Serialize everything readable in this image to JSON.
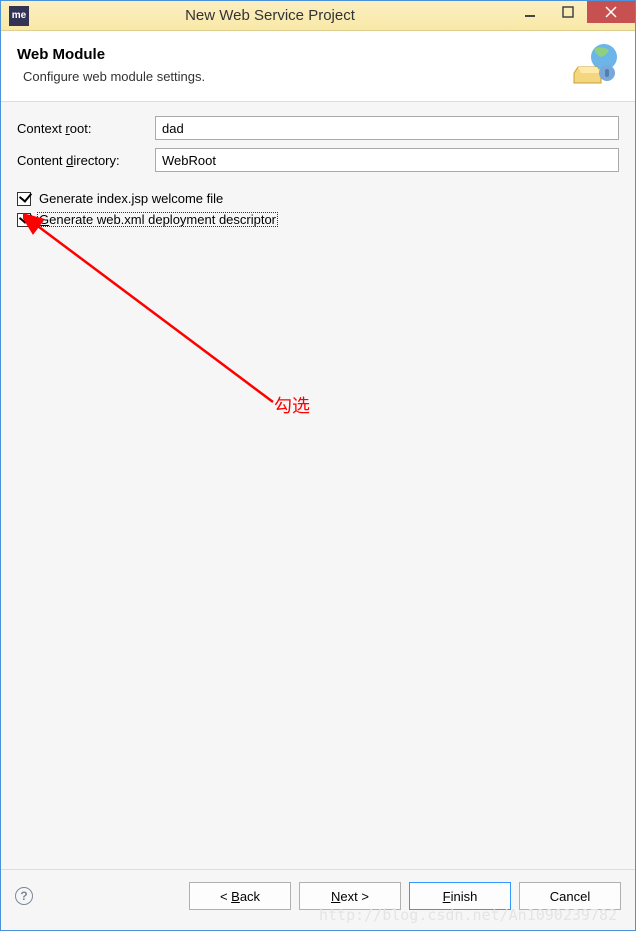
{
  "titlebar": {
    "icon_text": "me",
    "title": "New Web Service Project"
  },
  "header": {
    "title": "Web Module",
    "subtitle": "Configure web module settings."
  },
  "fields": {
    "context_root": {
      "label_pre": "Context ",
      "label_mn": "r",
      "label_post": "oot:",
      "value": "dad"
    },
    "content_dir": {
      "label_pre": "Content ",
      "label_mn": "d",
      "label_post": "irectory:",
      "value": "WebRoot"
    }
  },
  "checkboxes": {
    "index_jsp": {
      "label": "Generate index.jsp welcome file",
      "checked": true
    },
    "web_xml": {
      "label_mn": "G",
      "label_rest": "enerate web.xml deployment descriptor",
      "checked": true
    }
  },
  "annotation": {
    "text": "勾选"
  },
  "buttons": {
    "back": {
      "pre": "< ",
      "mn": "B",
      "post": "ack"
    },
    "next": {
      "mn": "N",
      "post": "ext >"
    },
    "finish": {
      "mn": "F",
      "post": "inish"
    },
    "cancel": {
      "label": "Cancel"
    }
  },
  "watermark": "http://blog.csdn.net/An1090239782"
}
